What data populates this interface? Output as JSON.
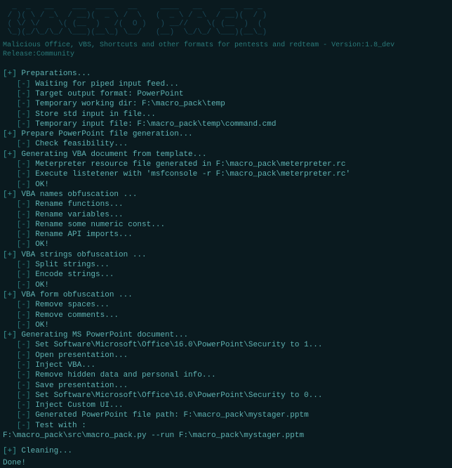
{
  "ascii": "  _  _   __    ___  ____   __     ____   __    ___  __ _\n / )( \\ / _\\  / __)(  _ \\ /  \\   (  _ \\ / _\\  / __)(  / )\n ( \\/ \\/    \\( (__  )   /(  O )   ) __//    \\( (__  )  (\n \\_)(_/\\_/\\_/ \\___)(__\\_) \\__/   (__)  \\_/\\_/ \\___)(__\\_)",
  "tagline": "  Malicious Office, VBS, Shortcuts and other formats for pentests and redteam - Version:1.8_dev Release:Community",
  "lines": [
    {
      "prefix": "[+]",
      "indent": 0,
      "text": " Preparations..."
    },
    {
      "prefix": "[-]",
      "indent": 1,
      "text": " Waiting for piped input feed..."
    },
    {
      "prefix": "[-]",
      "indent": 1,
      "text": " Target output format: PowerPoint"
    },
    {
      "prefix": "[-]",
      "indent": 1,
      "text": " Temporary working dir: F:\\macro_pack\\temp"
    },
    {
      "prefix": "[-]",
      "indent": 1,
      "text": " Store std input in file..."
    },
    {
      "prefix": "[-]",
      "indent": 1,
      "text": " Temporary input file: F:\\macro_pack\\temp\\command.cmd"
    },
    {
      "prefix": "[+]",
      "indent": 0,
      "text": " Prepare PowerPoint file generation..."
    },
    {
      "prefix": "[-]",
      "indent": 1,
      "text": " Check feasibility..."
    },
    {
      "prefix": "[+]",
      "indent": 0,
      "text": " Generating VBA document from template..."
    },
    {
      "prefix": "[-]",
      "indent": 1,
      "text": " Meterpreter resource file generated in F:\\macro_pack\\meterpreter.rc"
    },
    {
      "prefix": "[-]",
      "indent": 1,
      "text": " Execute listetener with 'msfconsole -r F:\\macro_pack\\meterpreter.rc'"
    },
    {
      "prefix": "[-]",
      "indent": 1,
      "text": " OK!"
    },
    {
      "prefix": "[+]",
      "indent": 0,
      "text": " VBA names obfuscation ..."
    },
    {
      "prefix": "[-]",
      "indent": 1,
      "text": " Rename functions..."
    },
    {
      "prefix": "[-]",
      "indent": 1,
      "text": " Rename variables..."
    },
    {
      "prefix": "[-]",
      "indent": 1,
      "text": " Rename some numeric const..."
    },
    {
      "prefix": "[-]",
      "indent": 1,
      "text": " Rename API imports..."
    },
    {
      "prefix": "[-]",
      "indent": 1,
      "text": " OK!"
    },
    {
      "prefix": "[+]",
      "indent": 0,
      "text": " VBA strings obfuscation ..."
    },
    {
      "prefix": "[-]",
      "indent": 1,
      "text": " Split strings..."
    },
    {
      "prefix": "[-]",
      "indent": 1,
      "text": " Encode strings..."
    },
    {
      "prefix": "[-]",
      "indent": 1,
      "text": " OK!"
    },
    {
      "prefix": "[+]",
      "indent": 0,
      "text": " VBA form obfuscation ..."
    },
    {
      "prefix": "[-]",
      "indent": 1,
      "text": " Remove spaces..."
    },
    {
      "prefix": "[-]",
      "indent": 1,
      "text": " Remove comments..."
    },
    {
      "prefix": "[-]",
      "indent": 1,
      "text": " OK!"
    },
    {
      "prefix": "[+]",
      "indent": 0,
      "text": " Generating MS PowerPoint document..."
    },
    {
      "prefix": "[-]",
      "indent": 1,
      "text": " Set Software\\Microsoft\\Office\\16.0\\PowerPoint\\Security to 1..."
    },
    {
      "prefix": "[-]",
      "indent": 1,
      "text": " Open presentation..."
    },
    {
      "prefix": "[-]",
      "indent": 1,
      "text": " Inject VBA..."
    },
    {
      "prefix": "[-]",
      "indent": 1,
      "text": " Remove hidden data and personal info..."
    },
    {
      "prefix": "[-]",
      "indent": 1,
      "text": " Save presentation..."
    },
    {
      "prefix": "[-]",
      "indent": 1,
      "text": " Set Software\\Microsoft\\Office\\16.0\\PowerPoint\\Security to 0..."
    },
    {
      "prefix": "[-]",
      "indent": 1,
      "text": " Inject Custom UI..."
    },
    {
      "prefix": "[-]",
      "indent": 1,
      "text": " Generated PowerPoint file path: F:\\macro_pack\\mystager.pptm"
    },
    {
      "prefix": "[-]",
      "indent": 1,
      "text": " Test with :"
    }
  ],
  "test_command": "F:\\macro_pack\\src\\macro_pack.py --run F:\\macro_pack\\mystager.pptm",
  "cleaning": {
    "prefix": "[+]",
    "text": " Cleaning..."
  },
  "done": "Done!"
}
